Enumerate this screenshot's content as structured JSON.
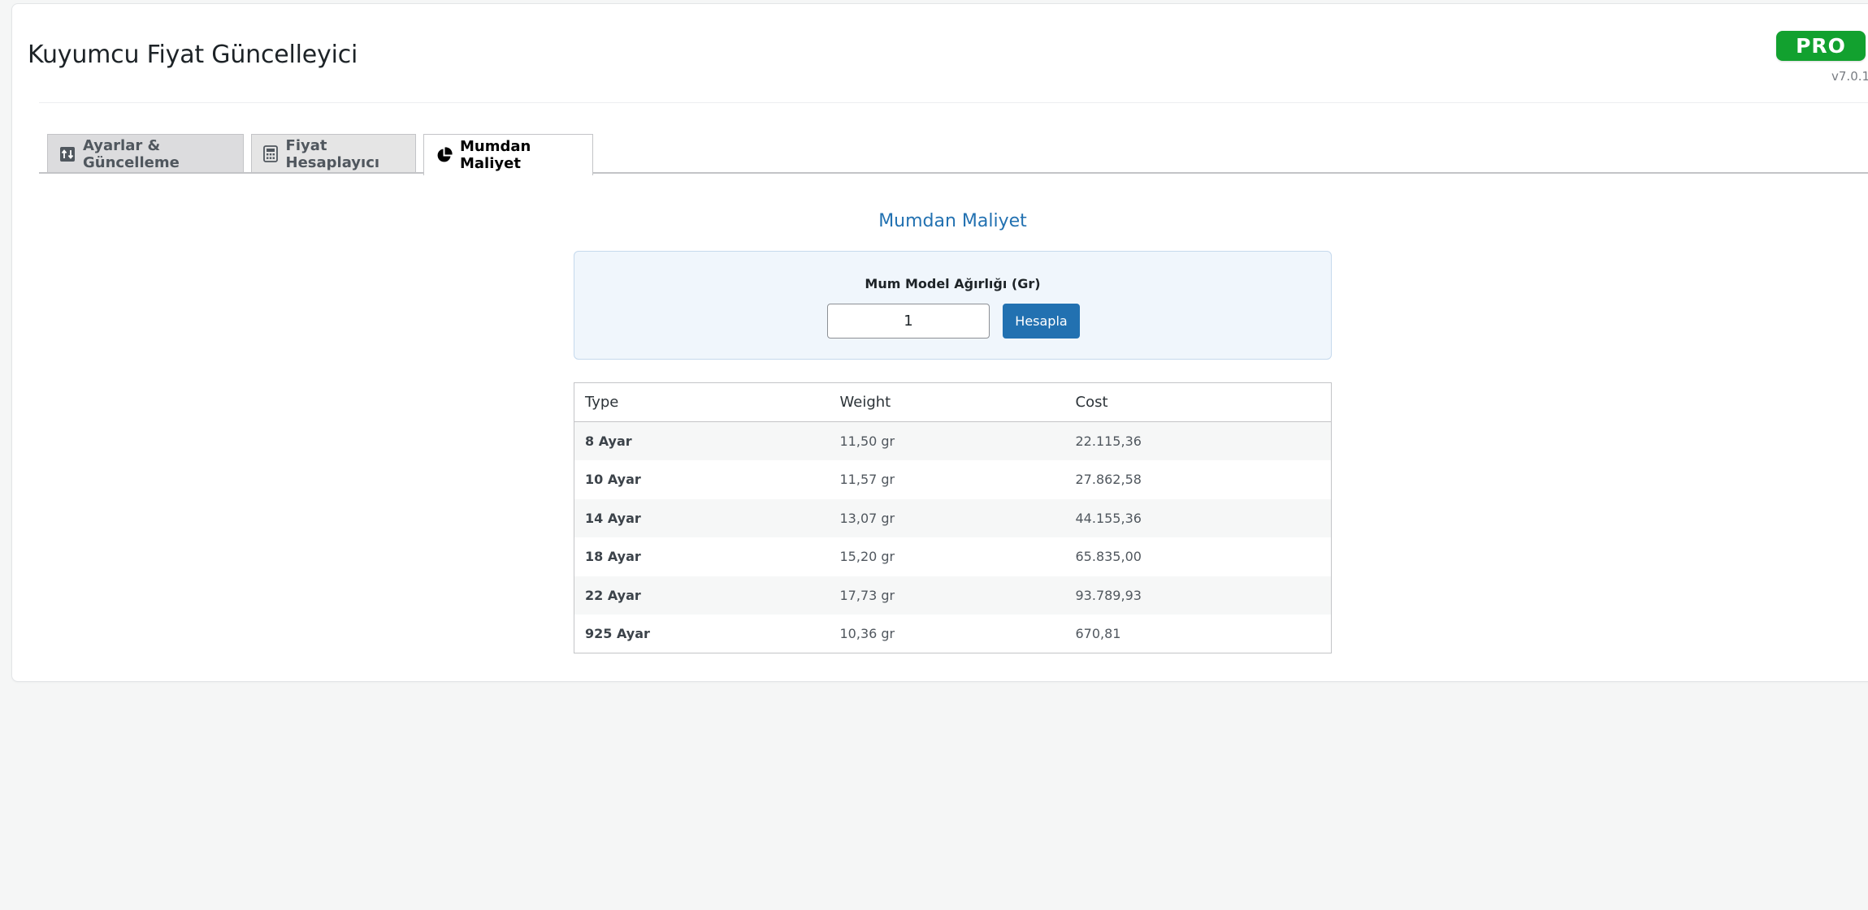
{
  "app": {
    "title": "Kuyumcu Fiyat Güncelleyici",
    "badge": "PRO",
    "version": "v7.0.1"
  },
  "tabs": [
    {
      "label": "Ayarlar & Güncelleme",
      "icon": "sort-arrows-icon",
      "active": false
    },
    {
      "label": "Fiyat Hesaplayıcı",
      "icon": "calculator-icon",
      "active": false
    },
    {
      "label": "Mumdan Maliyet",
      "icon": "pie-chart-icon",
      "active": true
    }
  ],
  "calculator": {
    "section_title": "Mumdan Maliyet",
    "input_label": "Mum Model Ağırlığı (Gr)",
    "input_value": "1",
    "button_label": "Hesapla"
  },
  "table": {
    "headers": [
      "Type",
      "Weight",
      "Cost"
    ],
    "rows": [
      {
        "type": "8 Ayar",
        "weight": "11,50 gr",
        "cost": "22.115,36"
      },
      {
        "type": "10 Ayar",
        "weight": "11,57 gr",
        "cost": "27.862,58"
      },
      {
        "type": "14 Ayar",
        "weight": "13,07 gr",
        "cost": "44.155,36"
      },
      {
        "type": "18 Ayar",
        "weight": "15,20 gr",
        "cost": "65.835,00"
      },
      {
        "type": "22 Ayar",
        "weight": "17,73 gr",
        "cost": "93.789,93"
      },
      {
        "type": "925 Ayar",
        "weight": "10,36 gr",
        "cost": "670,81"
      }
    ]
  },
  "colors": {
    "accent": "#2271b1",
    "badge": "#12a12f",
    "calc_bg": "#f0f6fc"
  }
}
